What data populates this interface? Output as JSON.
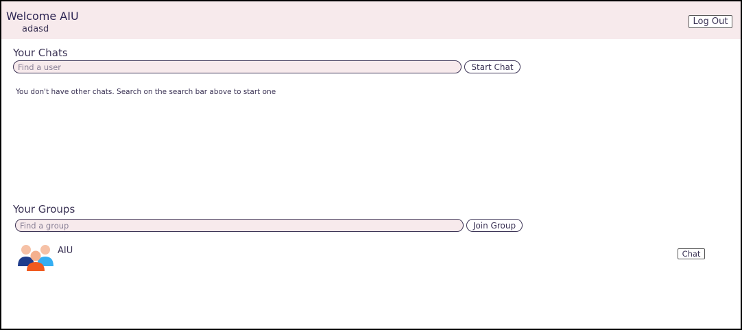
{
  "header": {
    "welcome": "Welcome AIU",
    "username": "adasd",
    "logout_label": "Log Out"
  },
  "chats": {
    "title": "Your Chats",
    "search_placeholder": "Find a user",
    "start_label": "Start Chat",
    "empty_message": "You don't have other chats. Search on the search bar above to start one"
  },
  "groups": {
    "title": "Your Groups",
    "search_placeholder": "Find a group",
    "join_label": "Join Group",
    "items": [
      {
        "name": "AIU",
        "icon": "group-people-icon",
        "chat_label": "Chat"
      }
    ]
  },
  "colors": {
    "header_bg": "#f7eaec",
    "text": "#3b3355",
    "accent_dark": "#2c2452"
  }
}
